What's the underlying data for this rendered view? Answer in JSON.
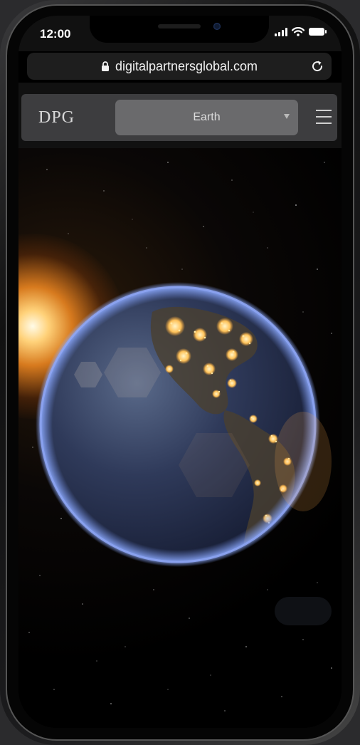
{
  "status": {
    "time": "12:00",
    "icons": [
      "signal-icon",
      "wifi-icon",
      "battery-icon"
    ]
  },
  "browser": {
    "url": "digitalpartnersglobal.com",
    "lock_icon": "lock-icon",
    "reload_icon": "reload-icon"
  },
  "site_nav": {
    "logo": "DPG",
    "select_value": "Earth",
    "menu_icon": "hamburger-menu-icon"
  },
  "hero": {
    "image": "earth-at-night-from-space"
  },
  "colors": {
    "nav_background": "#3d3d3f",
    "select_background": "#6a6a6c",
    "atmosphere": "#7f9cf0",
    "city_lights": "#ffd27a"
  }
}
